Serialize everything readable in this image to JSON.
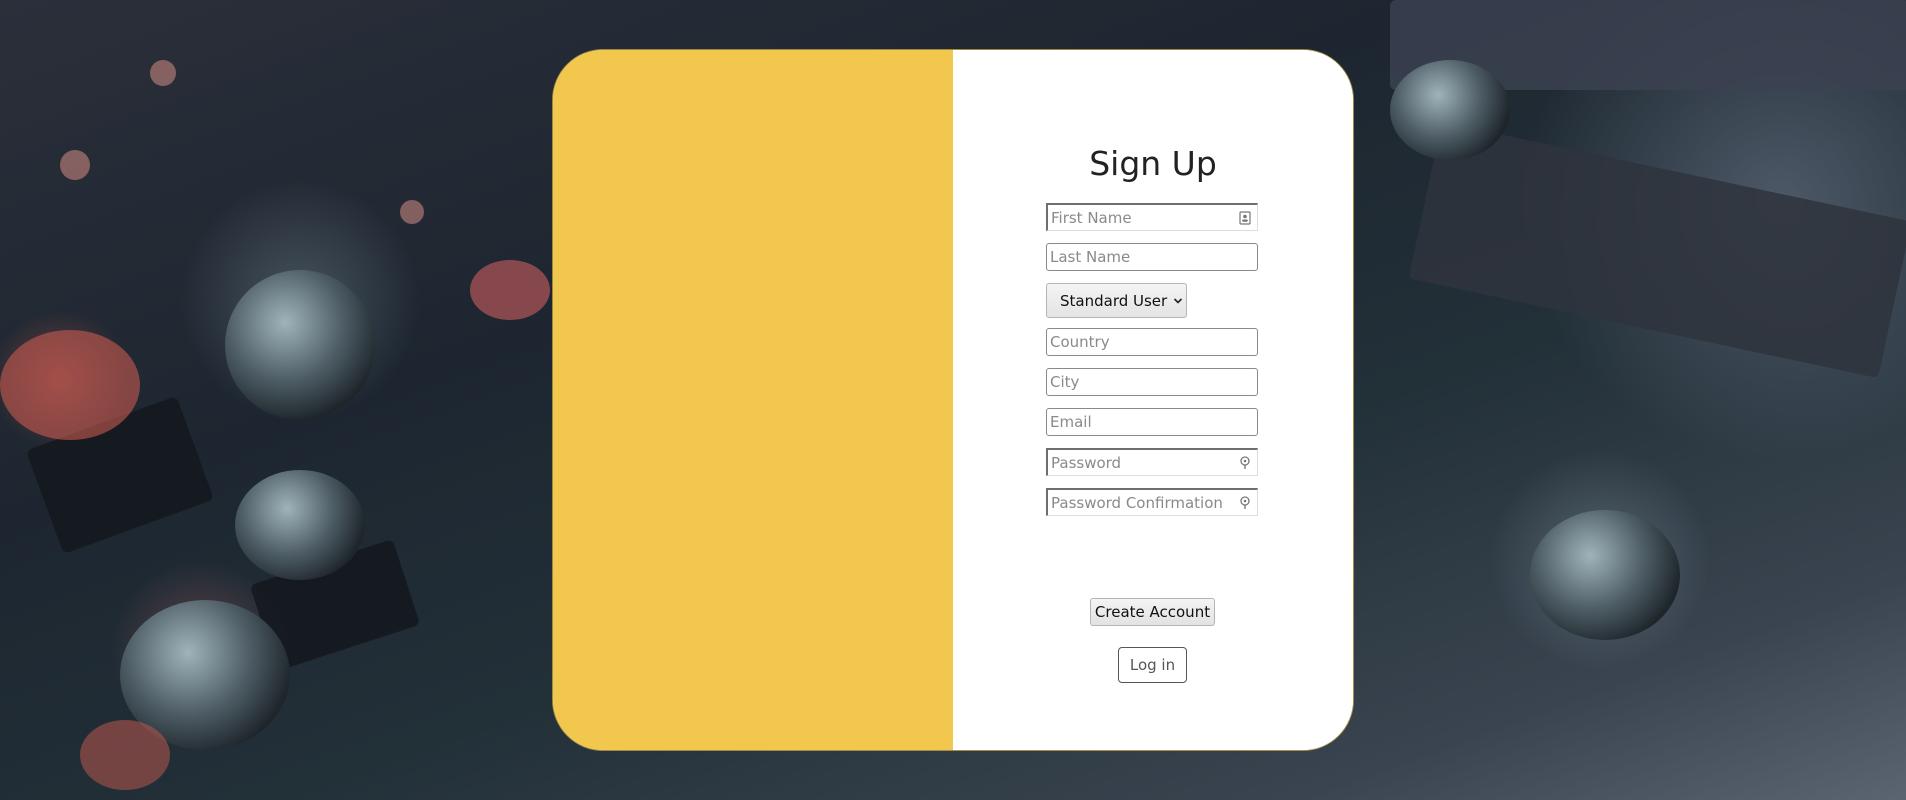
{
  "colors": {
    "accent_panel": "#f2c74d",
    "card_background": "#ffffff"
  },
  "signup": {
    "title": "Sign Up",
    "first_name": {
      "placeholder": "First Name",
      "value": "",
      "icon": "contact-card-icon"
    },
    "last_name": {
      "placeholder": "Last Name",
      "value": ""
    },
    "user_type": {
      "selected": "Standard User",
      "icon": "chevron-down-icon"
    },
    "country": {
      "placeholder": "Country",
      "value": ""
    },
    "city": {
      "placeholder": "City",
      "value": ""
    },
    "email": {
      "placeholder": "Email",
      "value": ""
    },
    "password": {
      "placeholder": "Password",
      "value": "",
      "icon": "key-icon"
    },
    "password_confirmation": {
      "placeholder": "Password Confirmation",
      "value": "",
      "icon": "key-icon"
    },
    "create_account_label": "Create Account",
    "login_label": "Log in"
  }
}
